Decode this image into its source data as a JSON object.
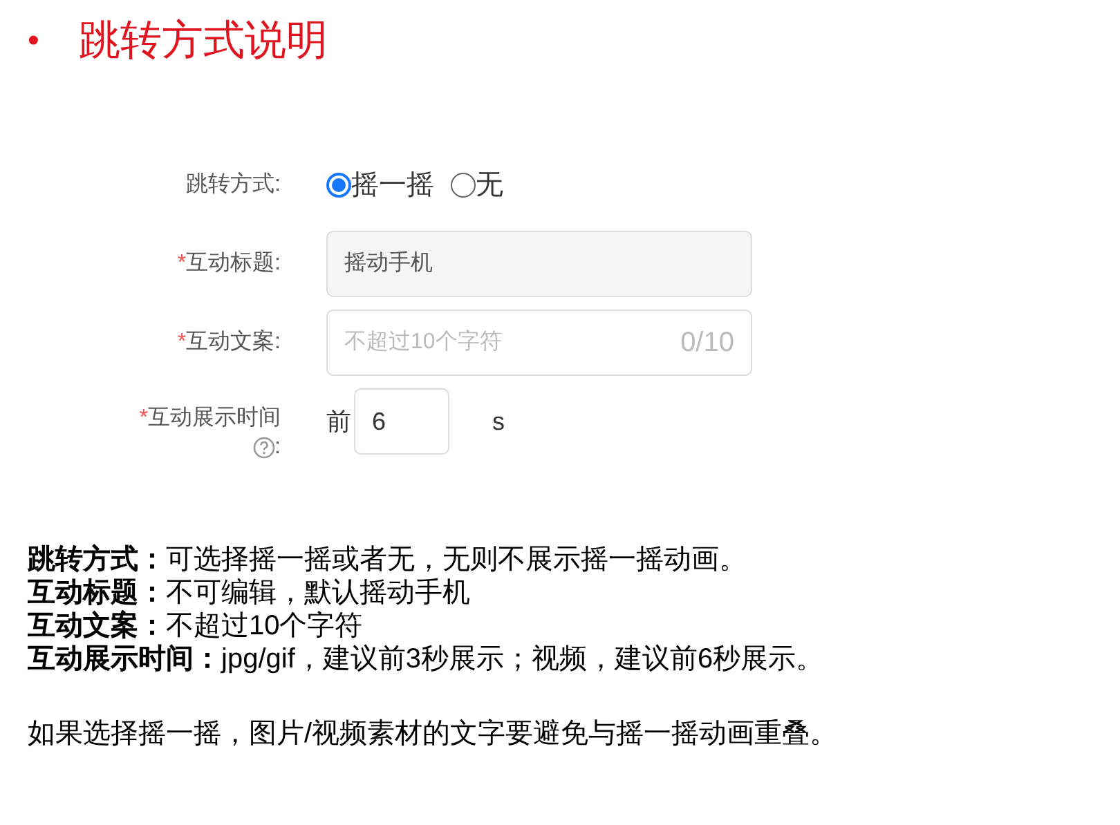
{
  "title": {
    "bullet": "•",
    "text": "跳转方式说明"
  },
  "form": {
    "rows": [
      {
        "kind": "radio",
        "label": "跳转方式:",
        "options": [
          {
            "label": "摇一摇",
            "selected": true
          },
          {
            "label": "无",
            "selected": false
          }
        ]
      },
      {
        "kind": "text",
        "required_mark": "*",
        "label": "互动标题:",
        "disabled": true,
        "value": "摇动手机"
      },
      {
        "kind": "text",
        "required_mark": "*",
        "label": "互动文案:",
        "placeholder": "不超过10个字符",
        "counter": "0/10"
      },
      {
        "kind": "time",
        "required_mark": "*",
        "label": "互动展示时间",
        "label_tail": ":",
        "prefix": "前",
        "value": "6",
        "unit": "s"
      }
    ]
  },
  "notes": [
    "**跳转方式：**可选择摇一摇或者无，无则不展示摇一摇动画。",
    "**互动标题：**不可编辑，默认摇动手机",
    "**互动文案：**不超过10个字符",
    "**互动展示时间：**jpg/gif，建议前3秒展示；视频，建议前6秒展示。"
  ],
  "footer": "如果选择摇一摇，图片/视频素材的文字要避免与摇一摇动画重叠。"
}
